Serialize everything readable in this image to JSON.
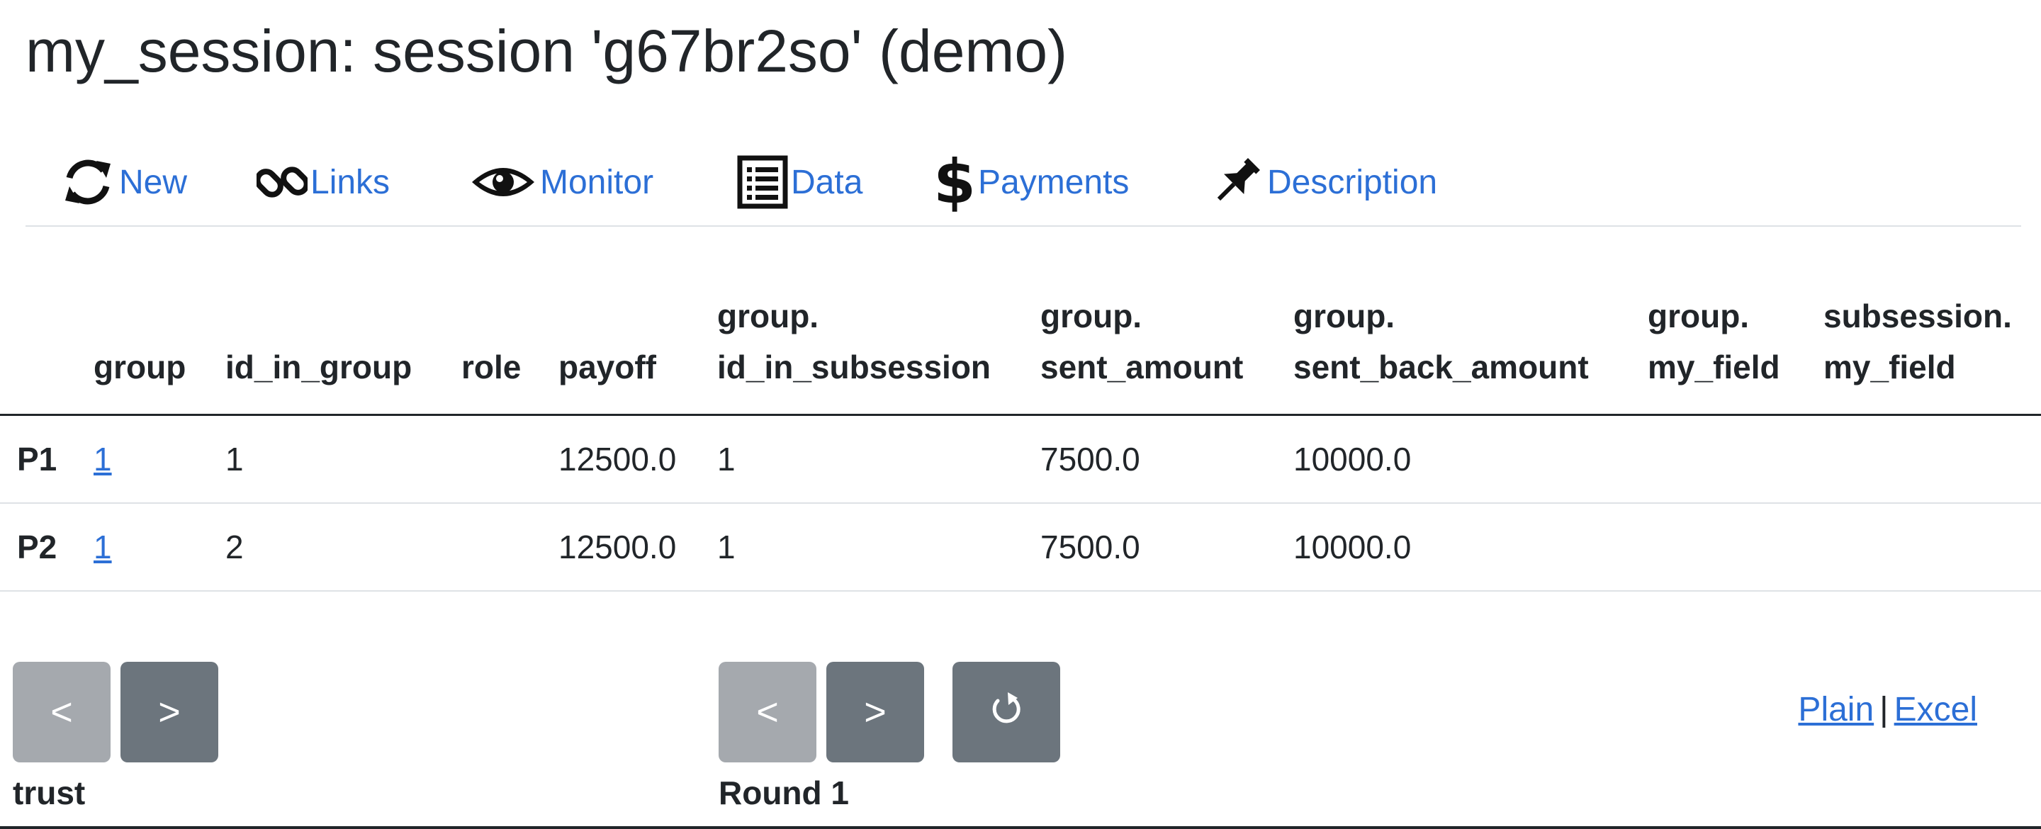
{
  "page_title": "my_session: session 'g67br2so' (demo)",
  "nav": {
    "items": [
      {
        "label": "New",
        "icon": "refresh-icon"
      },
      {
        "label": "Links",
        "icon": "link-icon"
      },
      {
        "label": "Monitor",
        "icon": "eye-icon"
      },
      {
        "label": "Data",
        "icon": "list-icon"
      },
      {
        "label": "Payments",
        "icon": "dollar-icon"
      },
      {
        "label": "Description",
        "icon": "pin-icon"
      }
    ]
  },
  "table": {
    "headers": [
      {
        "line1": "",
        "line2": ""
      },
      {
        "line1": "",
        "line2": "group"
      },
      {
        "line1": "",
        "line2": "id_in_group"
      },
      {
        "line1": "",
        "line2": "role"
      },
      {
        "line1": "",
        "line2": "payoff"
      },
      {
        "line1": "group.",
        "line2": "id_in_subsession"
      },
      {
        "line1": "group.",
        "line2": "sent_amount"
      },
      {
        "line1": "group.",
        "line2": "sent_back_amount"
      },
      {
        "line1": "group.",
        "line2": "my_field"
      },
      {
        "line1": "subsession.",
        "line2": "my_field"
      }
    ],
    "rows": [
      {
        "participant": "P1",
        "group": "1",
        "id_in_group": "1",
        "role": "",
        "payoff": "12500.0",
        "id_in_subsession": "1",
        "sent_amount": "7500.0",
        "sent_back_amount": "10000.0",
        "group_my_field": "",
        "subsession_my_field": ""
      },
      {
        "participant": "P2",
        "group": "1",
        "id_in_group": "2",
        "role": "",
        "payoff": "12500.0",
        "id_in_subsession": "1",
        "sent_amount": "7500.0",
        "sent_back_amount": "10000.0",
        "group_my_field": "",
        "subsession_my_field": ""
      }
    ]
  },
  "app_nav": {
    "prev_label": "<",
    "next_label": ">",
    "caption": "trust"
  },
  "round_nav": {
    "prev_label": "<",
    "next_label": ">",
    "caption": "Round 1",
    "refresh_icon": "refresh-icon"
  },
  "export": {
    "plain_label": "Plain",
    "separator": "|",
    "excel_label": "Excel"
  },
  "colors": {
    "link": "#2c6fd6",
    "button_enabled": "#6c757d",
    "button_disabled": "#a5a9ae",
    "text": "#212529"
  }
}
